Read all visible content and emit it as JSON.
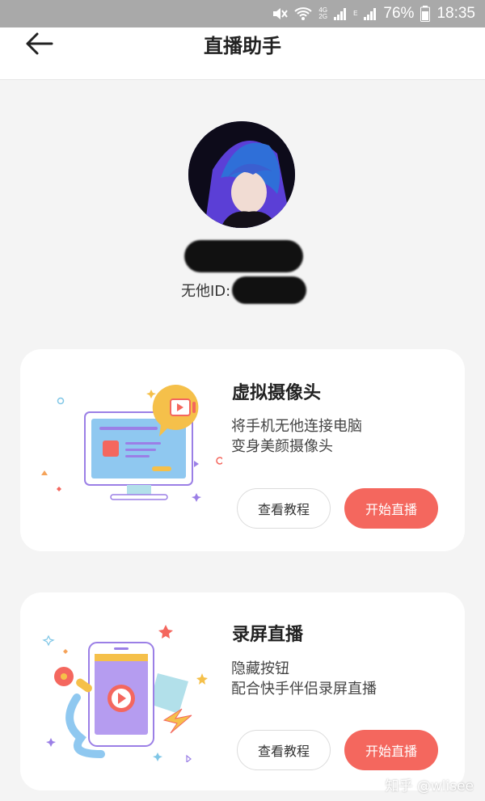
{
  "status_bar": {
    "network_top": "4G",
    "network_bottom": "2G",
    "network_e": "E",
    "battery": "76%",
    "time": "18:35",
    "icons": [
      "mute-icon",
      "wifi-icon",
      "signal-icon",
      "signal-icon",
      "battery-icon"
    ]
  },
  "header": {
    "title": "直播助手",
    "back_icon": "back-arrow-icon"
  },
  "profile": {
    "id_label": "无他ID:"
  },
  "cards": [
    {
      "title": "虚拟摄像头",
      "desc_line1": "将手机无他连接电脑",
      "desc_line2": "变身美颜摄像头",
      "tutorial_label": "查看教程",
      "start_label": "开始直播"
    },
    {
      "title": "录屏直播",
      "desc_line1": "隐藏按钮",
      "desc_line2": "配合快手伴侣录屏直播",
      "tutorial_label": "查看教程",
      "start_label": "开始直播"
    }
  ],
  "watermark": "知乎 @wlisee",
  "colors": {
    "accent": "#f4675e",
    "status_bar": "#a9a9a9",
    "background": "#f4f4f4",
    "card": "#ffffff"
  }
}
